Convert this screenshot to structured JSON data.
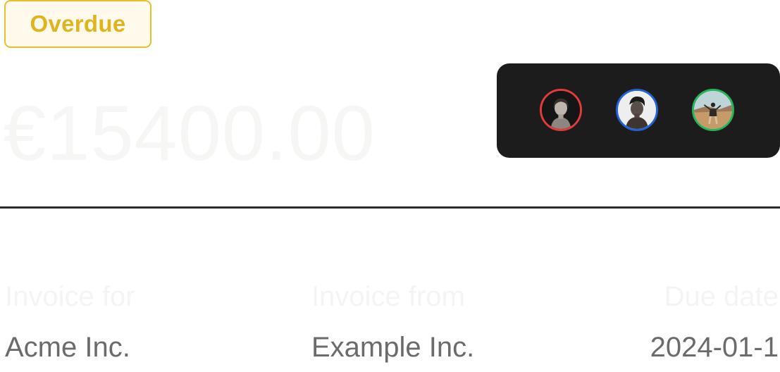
{
  "status": {
    "label": "Overdue",
    "color": "#e0b41e"
  },
  "invoice": {
    "amount": "€15400.00"
  },
  "assignees": [
    {
      "name": "avatar-woman",
      "ring_color": "#e33a3a"
    },
    {
      "name": "avatar-man",
      "ring_color": "#1f63d6"
    },
    {
      "name": "avatar-outdoor-person",
      "ring_color": "#27b55a"
    }
  ],
  "details": {
    "invoice_for": {
      "label": "Invoice for",
      "value": "Acme Inc."
    },
    "invoice_from": {
      "label": "Invoice from",
      "value": "Example Inc."
    },
    "due_date": {
      "label": "Due date",
      "value": "2024-01-1"
    }
  }
}
